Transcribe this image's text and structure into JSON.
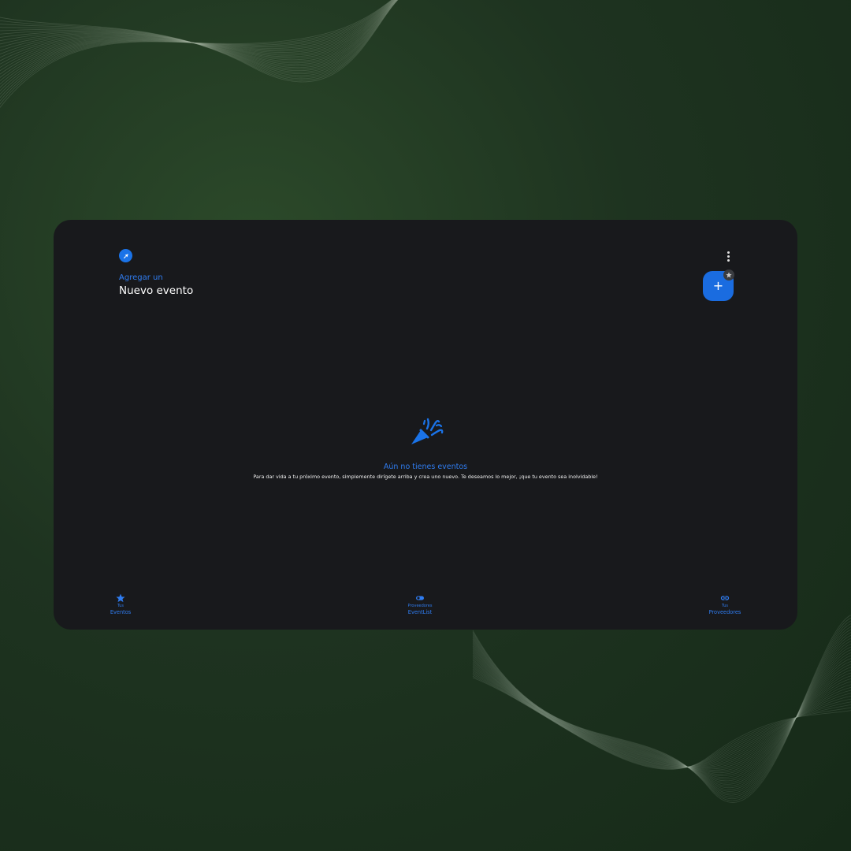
{
  "header": {
    "subtitle": "Agregar un",
    "title": "Nuevo evento",
    "add_label": "+"
  },
  "empty_state": {
    "title": "Aún no tienes eventos",
    "message": "Para dar vida a tu próximo evento, simplemente dirígete arriba y crea uno nuevo. Te deseamos lo mejor, ¡que tu evento sea inolvidable!"
  },
  "bottom_nav": [
    {
      "small": "Tus",
      "label": "Eventos",
      "icon": "star-icon"
    },
    {
      "small": "Proveedores",
      "label": "EventList",
      "icon": "toggle-icon"
    },
    {
      "small": "Tus",
      "label": "Proveedores",
      "icon": "link-icon"
    }
  ],
  "colors": {
    "accent": "#1a73e8",
    "card_bg": "#18191c",
    "page_bg": "#1e3320"
  }
}
